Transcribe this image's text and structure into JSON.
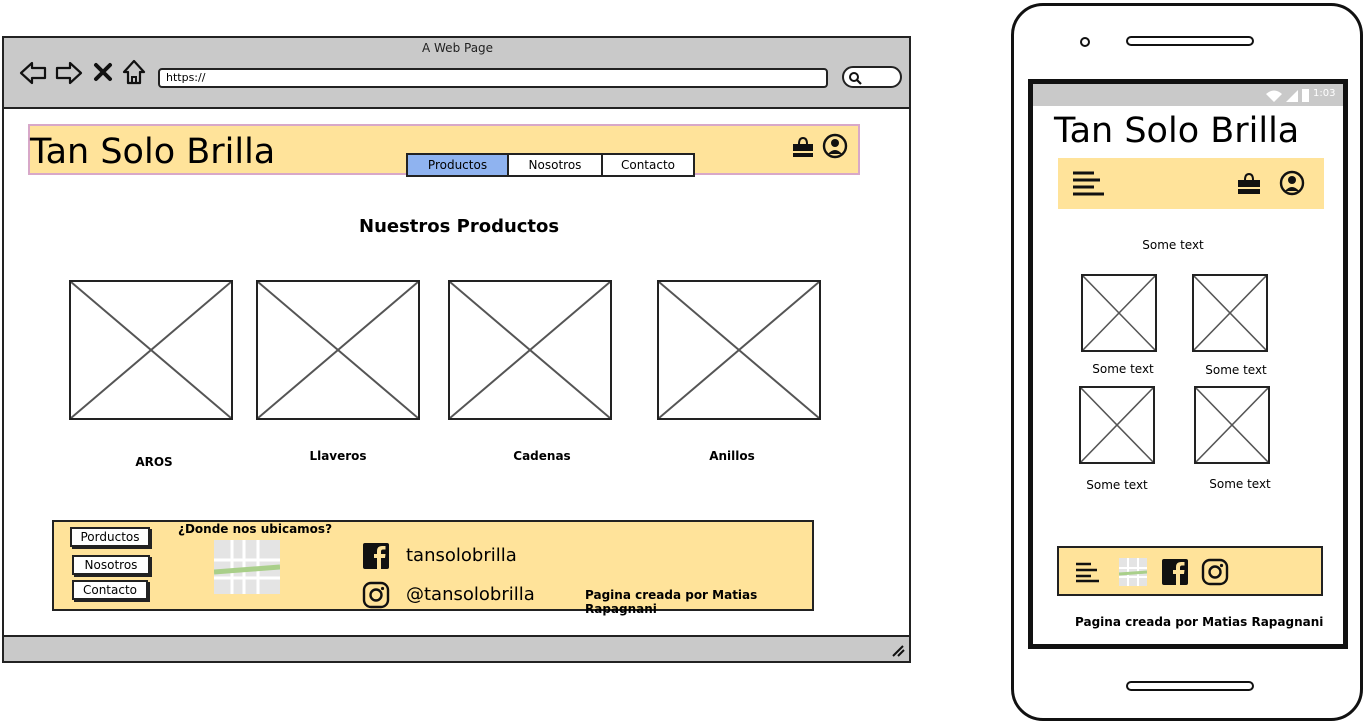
{
  "browser": {
    "window_title": "A Web Page",
    "url": "https://",
    "site": {
      "logo": "Tan Solo Brilla",
      "nav": [
        "Productos",
        "Nosotros",
        "Contacto"
      ],
      "section_title": "Nuestros Productos",
      "products": [
        "AROS",
        "Llaveros",
        "Cadenas",
        "Anillos"
      ],
      "footer": {
        "links": [
          "Porductos",
          "Nosotros",
          "Contacto"
        ],
        "location_title": "¿Donde nos ubicamos?",
        "facebook": "tansolobrilla",
        "instagram": "@tansolobrilla",
        "credit": "Pagina creada por Matias Rapagnani"
      }
    }
  },
  "phone": {
    "status_time": "1:03",
    "logo": "Tan Solo Brilla",
    "intro_text": "Some text",
    "product_captions": [
      "Some text",
      "Some text",
      "Some text",
      "Some text"
    ],
    "credit": "Pagina creada por Matias Rapagnani"
  },
  "colors": {
    "header_bg": "#ffe39a",
    "nav_active": "#8fb3f0",
    "chrome_gray": "#c9c9c9"
  },
  "icons": [
    "back-arrow-icon",
    "forward-arrow-icon",
    "close-icon",
    "home-icon",
    "search-icon",
    "shopping-bag-icon",
    "user-icon",
    "map-icon",
    "facebook-icon",
    "instagram-icon",
    "hamburger-menu-icon",
    "resize-grip-icon"
  ]
}
